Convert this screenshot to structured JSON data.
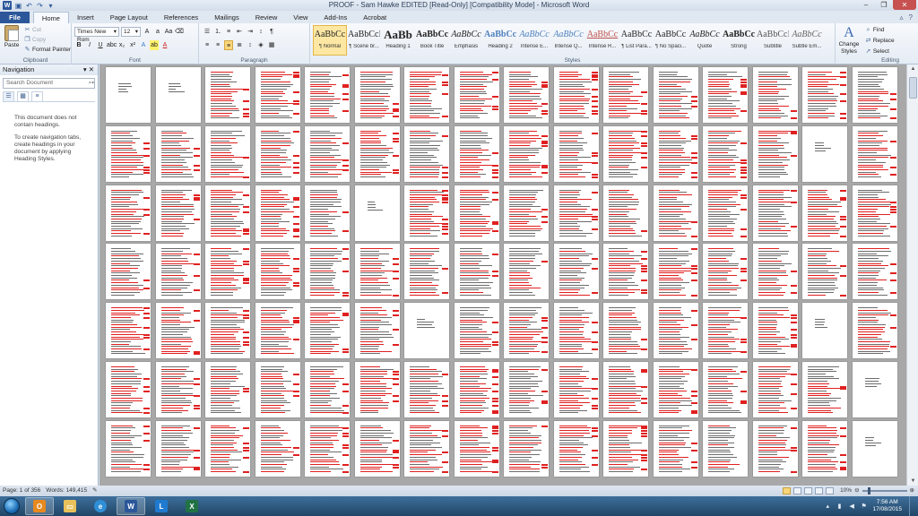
{
  "window": {
    "title": "PROOF - Sam Hawke EDITED [Read-Only] [Compatibility Mode] - Microsoft Word",
    "app_icon": "W"
  },
  "tabs": [
    "File",
    "Home",
    "Insert",
    "Page Layout",
    "References",
    "Mailings",
    "Review",
    "View",
    "Add-Ins",
    "Acrobat"
  ],
  "active_tab": "Home",
  "ribbon": {
    "clipboard": {
      "label": "Clipboard",
      "paste": "Paste",
      "cut": "Cut",
      "copy": "Copy",
      "format_painter": "Format Painter"
    },
    "font": {
      "label": "Font",
      "font_name": "Times New Rom",
      "font_size": "12"
    },
    "paragraph": {
      "label": "Paragraph"
    },
    "styles": {
      "label": "Styles",
      "items": [
        {
          "preview": "AaBbCc",
          "name": "¶ Normal",
          "selected": true
        },
        {
          "preview": "AaBbCcI",
          "name": "¶ Scene br..."
        },
        {
          "preview": "AaBb",
          "name": "Heading 1"
        },
        {
          "preview": "AaBbCc",
          "name": "Book Title"
        },
        {
          "preview": "AaBbCc",
          "name": "Emphasis"
        },
        {
          "preview": "AaBbCc",
          "name": "Heading 2"
        },
        {
          "preview": "AaBbCc",
          "name": "Intense E..."
        },
        {
          "preview": "AaBbCc",
          "name": "Intense Q..."
        },
        {
          "preview": "AaBbCc",
          "name": "Intense R..."
        },
        {
          "preview": "AaBbCc",
          "name": "¶ List Para..."
        },
        {
          "preview": "AaBbCc",
          "name": "¶ No Spaci..."
        },
        {
          "preview": "AaBbCc",
          "name": "Quote"
        },
        {
          "preview": "AaBbCc",
          "name": "Strong"
        },
        {
          "preview": "AaBbCcI",
          "name": "Subtitle"
        },
        {
          "preview": "AaBbCc",
          "name": "Subtle Em..."
        }
      ],
      "change_styles": "Change Styles"
    },
    "editing": {
      "label": "Editing",
      "find": "Find",
      "replace": "Replace",
      "select": "Select"
    }
  },
  "navigation": {
    "title": "Navigation",
    "search_placeholder": "Search Document",
    "message_1": "This document does not contain headings.",
    "message_2": "To create navigation tabs, create headings in your document by applying Heading Styles."
  },
  "status": {
    "page": "Page: 1 of 356",
    "words": "Words: 149,415",
    "zoom": "10%"
  },
  "taskbar": {
    "time": "7:56 AM",
    "date": "17/08/2015"
  },
  "colors": {
    "file_tab": "#2b579a",
    "markup_red": "#e02020",
    "selected_style": "#fde7a2"
  }
}
